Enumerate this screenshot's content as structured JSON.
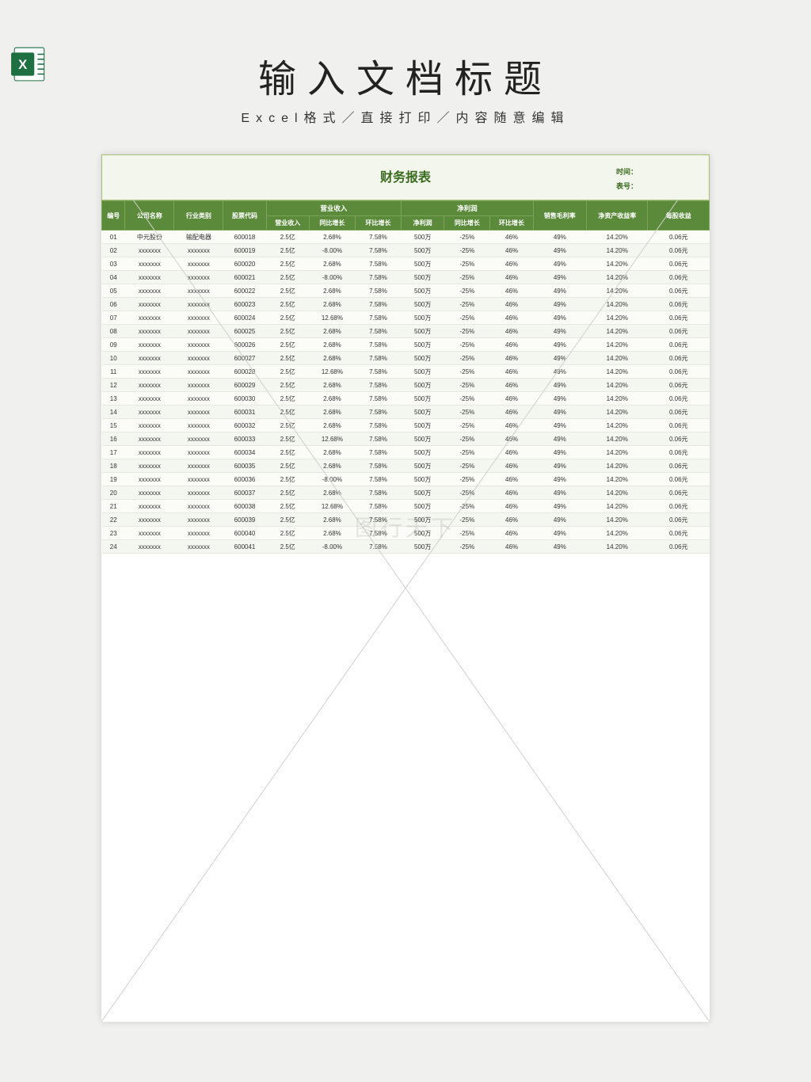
{
  "page": {
    "title": "输入文档标题",
    "subtitle": "Excel格式／直接打印／内容随意编辑",
    "watermark": "图行天下"
  },
  "report": {
    "title": "财务报表",
    "meta_time_label": "时间：",
    "meta_no_label": "表号："
  },
  "columns": {
    "id": "编号",
    "name": "公司名称",
    "industry": "行业类别",
    "code": "股票代码",
    "rev_group": "营业收入",
    "rev": "营业收入",
    "rev_yoy": "同比增长",
    "rev_mom": "环比增长",
    "np_group": "净利润",
    "np": "净利润",
    "np_yoy": "同比增长",
    "np_mom": "环比增长",
    "gm": "销售毛利率",
    "roe": "净资产收益率",
    "eps": "每股收益"
  },
  "rows": [
    {
      "id": "01",
      "name": "中元股份",
      "industry": "输配电器",
      "code": "600018",
      "rev": "2.5亿",
      "rev_yoy": "2.68%",
      "rev_mom": "7.58%",
      "np": "500万",
      "np_yoy": "-25%",
      "np_mom": "46%",
      "gm": "49%",
      "roe": "14.20%",
      "eps": "0.06元"
    },
    {
      "id": "02",
      "name": "xxxxxxx",
      "industry": "xxxxxxx",
      "code": "600019",
      "rev": "2.5亿",
      "rev_yoy": "-8.00%",
      "rev_mom": "7.58%",
      "np": "500万",
      "np_yoy": "-25%",
      "np_mom": "46%",
      "gm": "49%",
      "roe": "14.20%",
      "eps": "0.06元"
    },
    {
      "id": "03",
      "name": "xxxxxxx",
      "industry": "xxxxxxx",
      "code": "600020",
      "rev": "2.5亿",
      "rev_yoy": "2.68%",
      "rev_mom": "7.58%",
      "np": "500万",
      "np_yoy": "-25%",
      "np_mom": "46%",
      "gm": "49%",
      "roe": "14.20%",
      "eps": "0.06元"
    },
    {
      "id": "04",
      "name": "xxxxxxx",
      "industry": "xxxxxxx",
      "code": "600021",
      "rev": "2.5亿",
      "rev_yoy": "-8.00%",
      "rev_mom": "7.58%",
      "np": "500万",
      "np_yoy": "-25%",
      "np_mom": "46%",
      "gm": "49%",
      "roe": "14.20%",
      "eps": "0.06元"
    },
    {
      "id": "05",
      "name": "xxxxxxx",
      "industry": "xxxxxxx",
      "code": "600022",
      "rev": "2.5亿",
      "rev_yoy": "2.68%",
      "rev_mom": "7.58%",
      "np": "500万",
      "np_yoy": "-25%",
      "np_mom": "46%",
      "gm": "49%",
      "roe": "14.20%",
      "eps": "0.06元"
    },
    {
      "id": "06",
      "name": "xxxxxxx",
      "industry": "xxxxxxx",
      "code": "600023",
      "rev": "2.5亿",
      "rev_yoy": "2.68%",
      "rev_mom": "7.58%",
      "np": "500万",
      "np_yoy": "-25%",
      "np_mom": "46%",
      "gm": "49%",
      "roe": "14.20%",
      "eps": "0.06元"
    },
    {
      "id": "07",
      "name": "xxxxxxx",
      "industry": "xxxxxxx",
      "code": "600024",
      "rev": "2.5亿",
      "rev_yoy": "12.68%",
      "rev_mom": "7.58%",
      "np": "500万",
      "np_yoy": "-25%",
      "np_mom": "46%",
      "gm": "49%",
      "roe": "14.20%",
      "eps": "0.06元"
    },
    {
      "id": "08",
      "name": "xxxxxxx",
      "industry": "xxxxxxx",
      "code": "600025",
      "rev": "2.5亿",
      "rev_yoy": "2.68%",
      "rev_mom": "7.58%",
      "np": "500万",
      "np_yoy": "-25%",
      "np_mom": "46%",
      "gm": "49%",
      "roe": "14.20%",
      "eps": "0.06元"
    },
    {
      "id": "09",
      "name": "xxxxxxx",
      "industry": "xxxxxxx",
      "code": "600026",
      "rev": "2.5亿",
      "rev_yoy": "2.68%",
      "rev_mom": "7.58%",
      "np": "500万",
      "np_yoy": "-25%",
      "np_mom": "46%",
      "gm": "49%",
      "roe": "14.20%",
      "eps": "0.06元"
    },
    {
      "id": "10",
      "name": "xxxxxxx",
      "industry": "xxxxxxx",
      "code": "600027",
      "rev": "2.5亿",
      "rev_yoy": "2.68%",
      "rev_mom": "7.58%",
      "np": "500万",
      "np_yoy": "-25%",
      "np_mom": "46%",
      "gm": "49%",
      "roe": "14.20%",
      "eps": "0.06元"
    },
    {
      "id": "11",
      "name": "xxxxxxx",
      "industry": "xxxxxxx",
      "code": "600028",
      "rev": "2.5亿",
      "rev_yoy": "12.68%",
      "rev_mom": "7.58%",
      "np": "500万",
      "np_yoy": "-25%",
      "np_mom": "46%",
      "gm": "49%",
      "roe": "14.20%",
      "eps": "0.06元"
    },
    {
      "id": "12",
      "name": "xxxxxxx",
      "industry": "xxxxxxx",
      "code": "600029",
      "rev": "2.5亿",
      "rev_yoy": "2.68%",
      "rev_mom": "7.58%",
      "np": "500万",
      "np_yoy": "-25%",
      "np_mom": "46%",
      "gm": "49%",
      "roe": "14.20%",
      "eps": "0.06元"
    },
    {
      "id": "13",
      "name": "xxxxxxx",
      "industry": "xxxxxxx",
      "code": "600030",
      "rev": "2.5亿",
      "rev_yoy": "2.68%",
      "rev_mom": "7.58%",
      "np": "500万",
      "np_yoy": "-25%",
      "np_mom": "46%",
      "gm": "49%",
      "roe": "14.20%",
      "eps": "0.06元"
    },
    {
      "id": "14",
      "name": "xxxxxxx",
      "industry": "xxxxxxx",
      "code": "600031",
      "rev": "2.5亿",
      "rev_yoy": "2.68%",
      "rev_mom": "7.58%",
      "np": "500万",
      "np_yoy": "-25%",
      "np_mom": "46%",
      "gm": "49%",
      "roe": "14.20%",
      "eps": "0.06元"
    },
    {
      "id": "15",
      "name": "xxxxxxx",
      "industry": "xxxxxxx",
      "code": "600032",
      "rev": "2.5亿",
      "rev_yoy": "2.68%",
      "rev_mom": "7.58%",
      "np": "500万",
      "np_yoy": "-25%",
      "np_mom": "46%",
      "gm": "49%",
      "roe": "14.20%",
      "eps": "0.06元"
    },
    {
      "id": "16",
      "name": "xxxxxxx",
      "industry": "xxxxxxx",
      "code": "600033",
      "rev": "2.5亿",
      "rev_yoy": "12.68%",
      "rev_mom": "7.58%",
      "np": "500万",
      "np_yoy": "-25%",
      "np_mom": "46%",
      "gm": "49%",
      "roe": "14.20%",
      "eps": "0.06元"
    },
    {
      "id": "17",
      "name": "xxxxxxx",
      "industry": "xxxxxxx",
      "code": "600034",
      "rev": "2.5亿",
      "rev_yoy": "2.68%",
      "rev_mom": "7.58%",
      "np": "500万",
      "np_yoy": "-25%",
      "np_mom": "46%",
      "gm": "49%",
      "roe": "14.20%",
      "eps": "0.06元"
    },
    {
      "id": "18",
      "name": "xxxxxxx",
      "industry": "xxxxxxx",
      "code": "600035",
      "rev": "2.5亿",
      "rev_yoy": "2.68%",
      "rev_mom": "7.58%",
      "np": "500万",
      "np_yoy": "-25%",
      "np_mom": "46%",
      "gm": "49%",
      "roe": "14.20%",
      "eps": "0.06元"
    },
    {
      "id": "19",
      "name": "xxxxxxx",
      "industry": "xxxxxxx",
      "code": "600036",
      "rev": "2.5亿",
      "rev_yoy": "-8.00%",
      "rev_mom": "7.58%",
      "np": "500万",
      "np_yoy": "-25%",
      "np_mom": "46%",
      "gm": "49%",
      "roe": "14.20%",
      "eps": "0.06元"
    },
    {
      "id": "20",
      "name": "xxxxxxx",
      "industry": "xxxxxxx",
      "code": "600037",
      "rev": "2.5亿",
      "rev_yoy": "2.68%",
      "rev_mom": "7.58%",
      "np": "500万",
      "np_yoy": "-25%",
      "np_mom": "46%",
      "gm": "49%",
      "roe": "14.20%",
      "eps": "0.06元"
    },
    {
      "id": "21",
      "name": "xxxxxxx",
      "industry": "xxxxxxx",
      "code": "600038",
      "rev": "2.5亿",
      "rev_yoy": "12.68%",
      "rev_mom": "7.58%",
      "np": "500万",
      "np_yoy": "-25%",
      "np_mom": "46%",
      "gm": "49%",
      "roe": "14.20%",
      "eps": "0.06元"
    },
    {
      "id": "22",
      "name": "xxxxxxx",
      "industry": "xxxxxxx",
      "code": "600039",
      "rev": "2.5亿",
      "rev_yoy": "2.68%",
      "rev_mom": "7.58%",
      "np": "500万",
      "np_yoy": "-25%",
      "np_mom": "46%",
      "gm": "49%",
      "roe": "14.20%",
      "eps": "0.06元"
    },
    {
      "id": "23",
      "name": "xxxxxxx",
      "industry": "xxxxxxx",
      "code": "600040",
      "rev": "2.5亿",
      "rev_yoy": "2.68%",
      "rev_mom": "7.58%",
      "np": "500万",
      "np_yoy": "-25%",
      "np_mom": "46%",
      "gm": "49%",
      "roe": "14.20%",
      "eps": "0.06元"
    },
    {
      "id": "24",
      "name": "xxxxxxx",
      "industry": "xxxxxxx",
      "code": "600041",
      "rev": "2.5亿",
      "rev_yoy": "-8.00%",
      "rev_mom": "7.58%",
      "np": "500万",
      "np_yoy": "-25%",
      "np_mom": "46%",
      "gm": "49%",
      "roe": "14.20%",
      "eps": "0.06元"
    }
  ],
  "chart_data": {
    "type": "table",
    "title": "财务报表",
    "columns": [
      "编号",
      "公司名称",
      "行业类别",
      "股票代码",
      "营业收入",
      "营业收入-同比增长",
      "营业收入-环比增长",
      "净利润",
      "净利润-同比增长",
      "净利润-环比增长",
      "销售毛利率",
      "净资产收益率",
      "每股收益"
    ],
    "note": "See rows[] for full tabular data values"
  }
}
